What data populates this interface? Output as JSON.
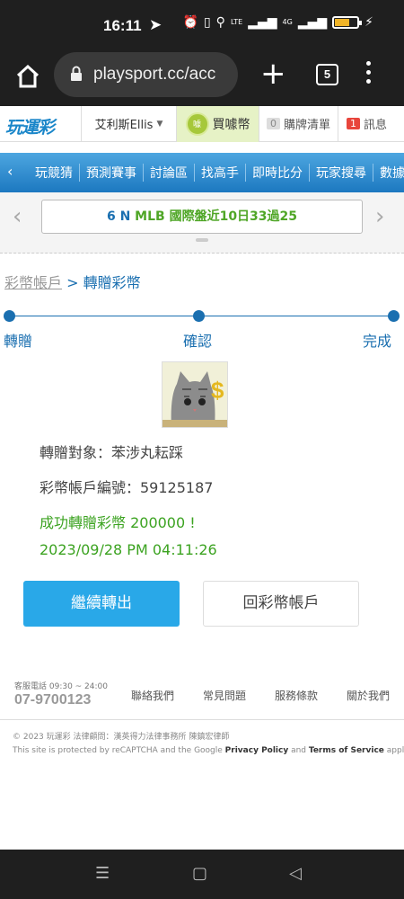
{
  "status_bar": {
    "time": "16:11",
    "lte": "LTE",
    "net": "4G"
  },
  "browser": {
    "url": "playsport.cc/acc",
    "tab_count": "5"
  },
  "header": {
    "logo": "玩運彩",
    "user": "艾利斯Ellis",
    "buy_label": "買噱幣",
    "coin_badge": "噱",
    "cart_count": "0",
    "cart_label": "購牌清單",
    "msg_count": "1",
    "msg_label": "訊息"
  },
  "nav": {
    "items": [
      "玩競猜",
      "預測賽事",
      "討論區",
      "找高手",
      "即時比分",
      "玩家搜尋",
      "數據"
    ]
  },
  "marquee": {
    "prefix": "6 N",
    "league": "MLB",
    "text": "國際盤近10日33過25"
  },
  "breadcrumb": {
    "parent": "彩幣帳戶",
    "sep": ">",
    "current": "轉贈彩幣"
  },
  "steps": {
    "labels": [
      "轉贈",
      "確認",
      "完成"
    ]
  },
  "result": {
    "target": "轉贈對象：苯涉丸耘踩",
    "account": "彩幣帳戶編號：59125187",
    "success": "成功轉贈彩幣 200000 !",
    "datetime": "2023/09/28 PM 04:11:26"
  },
  "buttons": {
    "continue": "繼續轉出",
    "back": "回彩幣帳戶"
  },
  "footer": {
    "phone_label": "客服電話 09:30 ~ 24:00",
    "phone": "07-9700123",
    "links": [
      "聯絡我們",
      "常見問題",
      "服務條款",
      "關於我們"
    ],
    "copyright": "© 2023 玩運彩 法律顧問：漢英得力法律事務所 陳鎮宏律師",
    "recaptcha_prefix": "This site is protected by reCAPTCHA and the Google ",
    "privacy": "Privacy Policy",
    "and": " and ",
    "terms": "Terms of Service",
    "apply": " apply."
  },
  "colors": {
    "brand_blue": "#1a6fb0",
    "nav_blue": "#1c78c0",
    "button_blue": "#29a8e8",
    "success_green": "#3ca321"
  }
}
